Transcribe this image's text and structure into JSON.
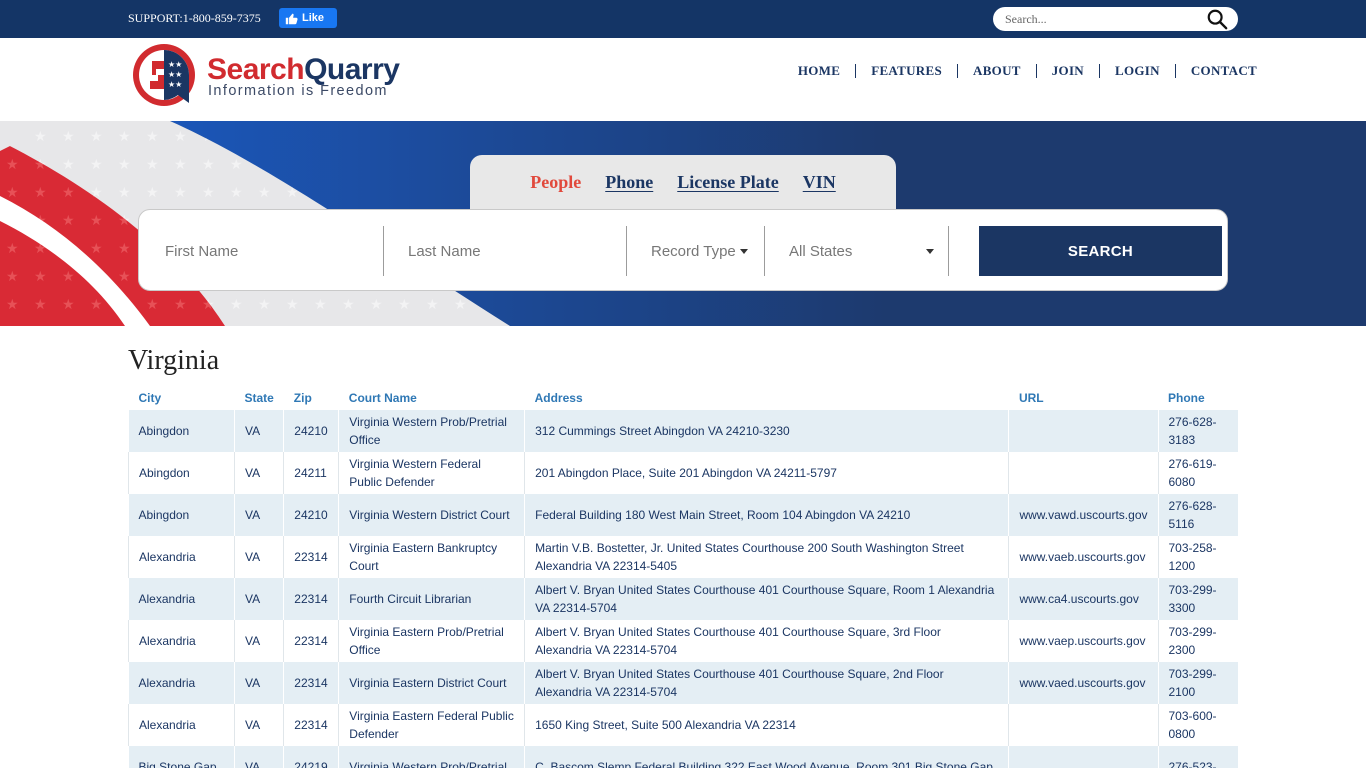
{
  "topbar": {
    "support": "SUPPORT:1-800-859-7375",
    "like_label": "Like",
    "search_placeholder": "Search..."
  },
  "header": {
    "logo_part1": "Search",
    "logo_part2": "Quarry",
    "logo_tagline": "Information is Freedom",
    "nav": [
      "HOME",
      "FEATURES",
      "ABOUT",
      "JOIN",
      "LOGIN",
      "CONTACT"
    ]
  },
  "search": {
    "tabs": [
      "People",
      "Phone",
      "License Plate",
      "VIN"
    ],
    "active_tab": "People",
    "first_name_placeholder": "First Name",
    "last_name_placeholder": "Last Name",
    "record_type": "Record Type",
    "state": "All States",
    "button_label": "SEARCH"
  },
  "content": {
    "title": "Virginia",
    "columns": [
      "City",
      "State",
      "Zip",
      "Court Name",
      "Address",
      "URL",
      "Phone"
    ],
    "rows": [
      {
        "city": "Abingdon",
        "state": "VA",
        "zip": "24210",
        "court": "Virginia Western Prob/Pretrial Office",
        "address": "312 Cummings Street Abingdon VA 24210-3230",
        "url": "",
        "phone": "276-628-3183"
      },
      {
        "city": "Abingdon",
        "state": "VA",
        "zip": "24211",
        "court": "Virginia Western Federal Public Defender",
        "address": "201 Abingdon Place, Suite 201 Abingdon VA 24211-5797",
        "url": "",
        "phone": "276-619-6080"
      },
      {
        "city": "Abingdon",
        "state": "VA",
        "zip": "24210",
        "court": "Virginia Western District Court",
        "address": "Federal Building 180 West Main Street, Room 104 Abingdon VA 24210",
        "url": "www.vawd.uscourts.gov",
        "phone": "276-628-5116"
      },
      {
        "city": "Alexandria",
        "state": "VA",
        "zip": "22314",
        "court": "Virginia Eastern Bankruptcy Court",
        "address": "Martin V.B. Bostetter, Jr. United States Courthouse 200 South Washington Street Alexandria VA 22314-5405",
        "url": "www.vaeb.uscourts.gov",
        "phone": "703-258-1200"
      },
      {
        "city": "Alexandria",
        "state": "VA",
        "zip": "22314",
        "court": "Fourth Circuit Librarian",
        "address": "Albert V. Bryan United States Courthouse 401 Courthouse Square, Room 1 Alexandria VA 22314-5704",
        "url": "www.ca4.uscourts.gov",
        "phone": "703-299-3300"
      },
      {
        "city": "Alexandria",
        "state": "VA",
        "zip": "22314",
        "court": "Virginia Eastern Prob/Pretrial Office",
        "address": "Albert V. Bryan United States Courthouse 401 Courthouse Square, 3rd Floor Alexandria VA 22314-5704",
        "url": "www.vaep.uscourts.gov",
        "phone": "703-299-2300"
      },
      {
        "city": "Alexandria",
        "state": "VA",
        "zip": "22314",
        "court": "Virginia Eastern District Court",
        "address": "Albert V. Bryan United States Courthouse 401 Courthouse Square, 2nd Floor Alexandria VA 22314-5704",
        "url": "www.vaed.uscourts.gov",
        "phone": "703-299-2100"
      },
      {
        "city": "Alexandria",
        "state": "VA",
        "zip": "22314",
        "court": "Virginia Eastern Federal Public Defender",
        "address": "1650 King Street, Suite 500 Alexandria VA 22314",
        "url": "",
        "phone": "703-600-0800"
      },
      {
        "city": "Big Stone Gap",
        "state": "VA",
        "zip": "24219",
        "court": "Virginia Western Prob/Pretrial",
        "address": "C. Bascom Slemp Federal Building 322 East Wood Avenue, Room 301 Big Stone Gap",
        "url": "",
        "phone": "276-523-"
      }
    ]
  }
}
